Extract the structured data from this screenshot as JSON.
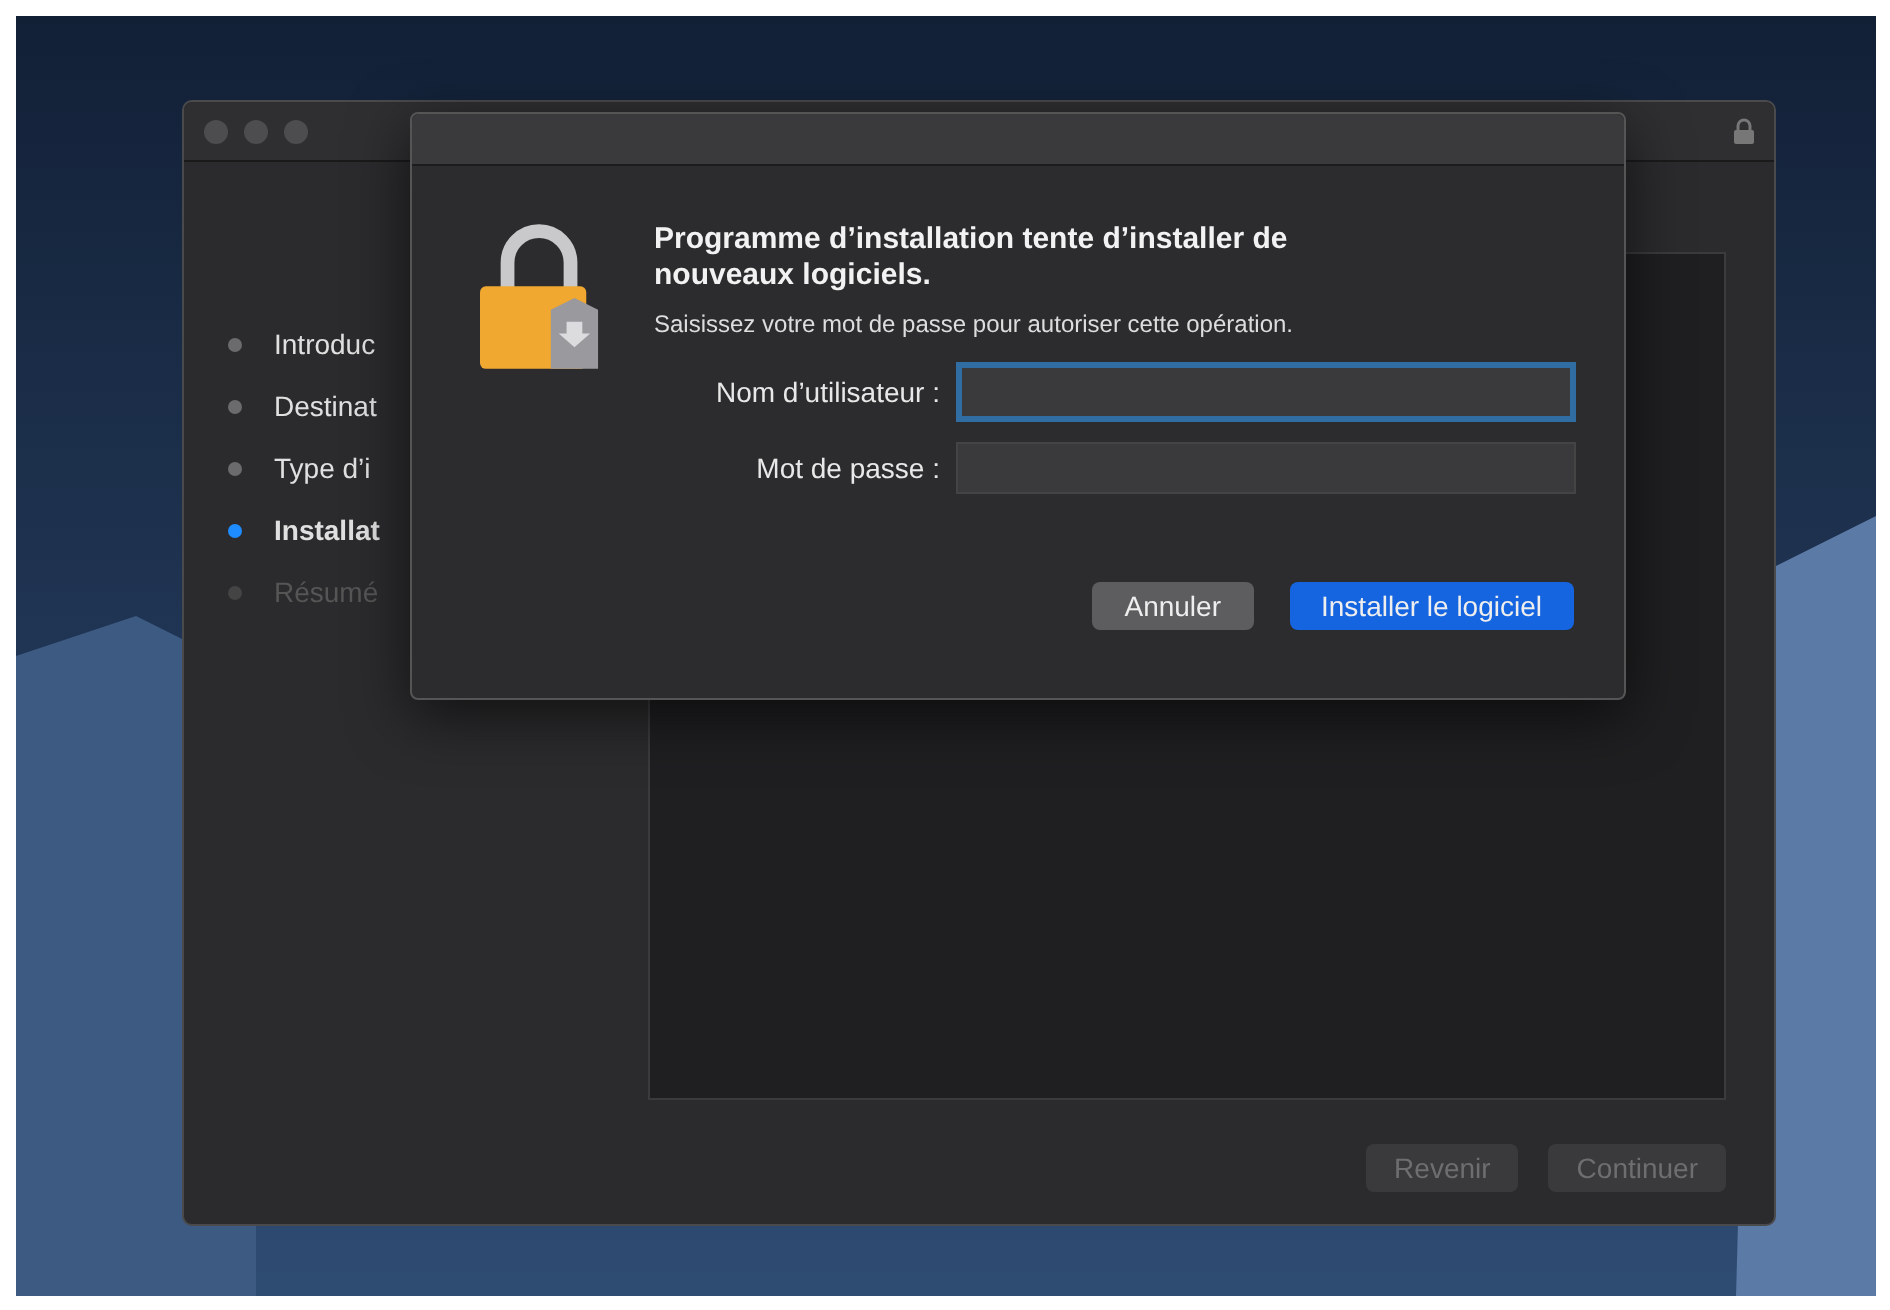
{
  "installer_window": {
    "steps": [
      {
        "label": "Introduc",
        "selected": false,
        "disabled": false
      },
      {
        "label": "Destinat",
        "selected": false,
        "disabled": false
      },
      {
        "label": "Type d’i",
        "selected": false,
        "disabled": false
      },
      {
        "label": "Installat",
        "selected": true,
        "disabled": false
      },
      {
        "label": "Résumé",
        "selected": false,
        "disabled": true
      }
    ],
    "buttons": [
      {
        "label": "Revenir",
        "disabled": true
      },
      {
        "label": "Continuer",
        "disabled": true
      }
    ]
  },
  "auth_dialog": {
    "title": "Programme d’installation tente d’installer de nouveaux logiciels.",
    "message": "Saisissez votre mot de passe pour autoriser cette opération.",
    "fields": [
      {
        "label": "Nom d’utilisateur :",
        "focused": true
      },
      {
        "label": "Mot de passe :",
        "focused": false
      }
    ],
    "buttons": [
      {
        "label": "Annuler",
        "default": false
      },
      {
        "label": "Installer le logiciel",
        "default": true
      }
    ]
  }
}
